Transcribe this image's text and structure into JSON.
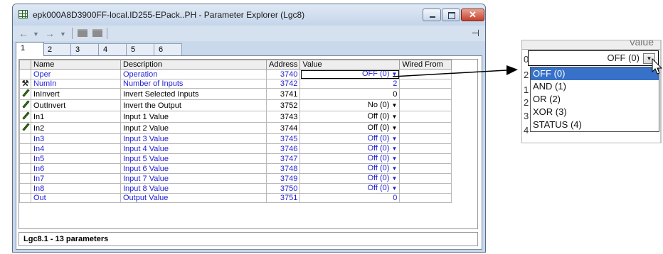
{
  "window": {
    "title": "epk000A8D3900FF-local.ID255-EPack..PH - Parameter Explorer (Lgc8)",
    "close_glyph": "✕"
  },
  "toolbar": {
    "back_icon": "←",
    "dropdown_icon": "▼",
    "forward_icon": "→",
    "pin_icon": "⊣"
  },
  "tabs": [
    "1",
    "2",
    "3",
    "4",
    "5",
    "6"
  ],
  "grid": {
    "columns": [
      "",
      "Name",
      "Description",
      "Address",
      "Value",
      "Wired From"
    ],
    "rows": [
      {
        "icon": "",
        "name": "Oper",
        "description": "Operation",
        "address": "3740",
        "value": "OFF (0)",
        "wired": "",
        "blue": true,
        "dropdown": true,
        "selected": true
      },
      {
        "icon": "wrench-icon",
        "name": "NumIn",
        "description": "Number of Inputs",
        "address": "3742",
        "value": "2",
        "wired": "",
        "blue": true,
        "dropdown": false
      },
      {
        "icon": "pencil-icon",
        "name": "InInvert",
        "description": "Invert Selected Inputs",
        "address": "3741",
        "value": "0",
        "wired": "",
        "blue": false,
        "dropdown": false
      },
      {
        "icon": "pencil-icon",
        "name": "OutInvert",
        "description": "Invert the Output",
        "address": "3752",
        "value": "No (0)",
        "wired": "",
        "blue": false,
        "dropdown": true
      },
      {
        "icon": "pencil-icon",
        "name": "In1",
        "description": "Input 1 Value",
        "address": "3743",
        "value": "Off (0)",
        "wired": "",
        "blue": false,
        "dropdown": true
      },
      {
        "icon": "pencil-icon",
        "name": "In2",
        "description": "Input 2 Value",
        "address": "3744",
        "value": "Off (0)",
        "wired": "",
        "blue": false,
        "dropdown": true
      },
      {
        "icon": "",
        "name": "In3",
        "description": "Input 3 Value",
        "address": "3745",
        "value": "Off (0)",
        "wired": "",
        "blue": true,
        "dropdown": true
      },
      {
        "icon": "",
        "name": "In4",
        "description": "Input 4 Value",
        "address": "3746",
        "value": "Off (0)",
        "wired": "",
        "blue": true,
        "dropdown": true
      },
      {
        "icon": "",
        "name": "In5",
        "description": "Input 5 Value",
        "address": "3747",
        "value": "Off (0)",
        "wired": "",
        "blue": true,
        "dropdown": true
      },
      {
        "icon": "",
        "name": "In6",
        "description": "Input 6 Value",
        "address": "3748",
        "value": "Off (0)",
        "wired": "",
        "blue": true,
        "dropdown": true
      },
      {
        "icon": "",
        "name": "In7",
        "description": "Input 7 Value",
        "address": "3749",
        "value": "Off (0)",
        "wired": "",
        "blue": true,
        "dropdown": true
      },
      {
        "icon": "",
        "name": "In8",
        "description": "Input 8 Value",
        "address": "3750",
        "value": "Off (0)",
        "wired": "",
        "blue": true,
        "dropdown": true
      },
      {
        "icon": "",
        "name": "Out",
        "description": "Output Value",
        "address": "3751",
        "value": "0",
        "wired": "",
        "blue": true,
        "dropdown": false
      }
    ]
  },
  "status": {
    "text": "Lgc8.1  -  13 parameters"
  },
  "zoom": {
    "header_label": "Value",
    "current_value": "OFF (0)",
    "row_numbers": [
      "0",
      "2",
      "1",
      "2",
      "3",
      "4"
    ],
    "options": [
      "OFF (0)",
      "AND (1)",
      "OR (2)",
      "XOR (3)",
      "STATUS (4)"
    ],
    "selected_index": 0
  },
  "colors": {
    "link_blue": "#1f1fd6",
    "selection_blue": "#3771c8"
  }
}
